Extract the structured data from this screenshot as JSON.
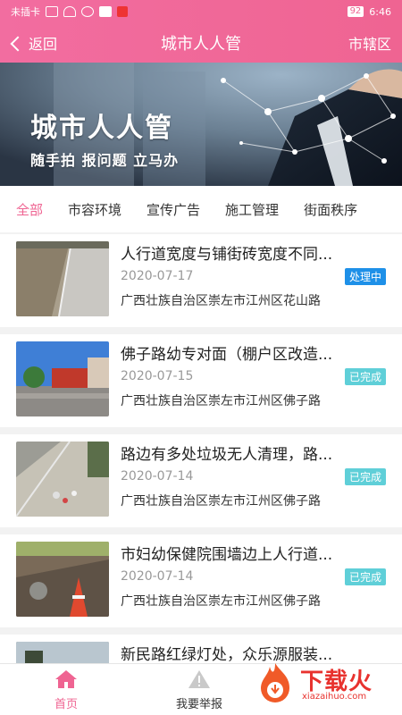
{
  "statusbar": {
    "carrier": "未插卡",
    "battery": "92",
    "time": "6:46"
  },
  "header": {
    "back_label": "返回",
    "title": "城市人人管",
    "right_action": "市辖区"
  },
  "banner": {
    "title": "城市人人管",
    "subtitle": "随手拍 报问题 立马办"
  },
  "tabs": [
    "全部",
    "市容环境",
    "宣传广告",
    "施工管理",
    "街面秩序"
  ],
  "tab_active_index": 0,
  "colors": {
    "accent": "#ef6492",
    "badge_processing": "#1e90e8",
    "badge_done": "#5fcfd8"
  },
  "items": [
    {
      "title": "人行道宽度与铺街砖宽度不同...",
      "date": "2020-07-17",
      "status": "处理中",
      "address": "广西壮族自治区崇左市江州区花山路"
    },
    {
      "title": "佛子路幼专对面（棚户区改造...",
      "date": "2020-07-15",
      "status": "已完成",
      "address": "广西壮族自治区崇左市江州区佛子路"
    },
    {
      "title": "路边有多处垃圾无人清理，路...",
      "date": "2020-07-14",
      "status": "已完成",
      "address": "广西壮族自治区崇左市江州区佛子路"
    },
    {
      "title": "市妇幼保健院围墙边上人行道...",
      "date": "2020-07-14",
      "status": "已完成",
      "address": "广西壮族自治区崇左市江州区佛子路"
    },
    {
      "title": "新民路红绿灯处，众乐源服装...",
      "date": "",
      "status": "",
      "address": ""
    }
  ],
  "bottom_nav": [
    {
      "label": "首页",
      "icon": "home-icon",
      "active": true
    },
    {
      "label": "我要举报",
      "icon": "warning-icon",
      "active": false
    }
  ],
  "watermark": {
    "text": "下载火",
    "url_text": "xiazaihuo.com"
  }
}
